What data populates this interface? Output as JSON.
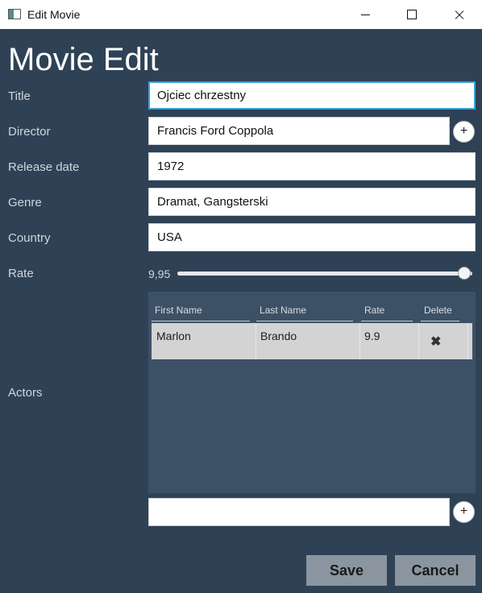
{
  "window": {
    "title": "Edit Movie"
  },
  "heading": "Movie Edit",
  "labels": {
    "title": "Title",
    "director": "Director",
    "release_date": "Release date",
    "genre": "Genre",
    "country": "Country",
    "rate": "Rate",
    "actors": "Actors"
  },
  "fields": {
    "title": "Ojciec chrzestny",
    "director": "Francis Ford Coppola",
    "release_date": "1972",
    "genre": "Dramat, Gangsterski",
    "country": "USA",
    "new_actor": ""
  },
  "rate": {
    "display": "9,95",
    "value": 9.95,
    "max": 10
  },
  "actors_table": {
    "columns": [
      "First Name",
      "Last Name",
      "Rate",
      "Delete"
    ],
    "rows": [
      {
        "first_name": "Marlon",
        "last_name": "Brando",
        "rate": "9.9",
        "delete_icon": "✖"
      }
    ]
  },
  "buttons": {
    "add": "+",
    "save": "Save",
    "cancel": "Cancel"
  }
}
